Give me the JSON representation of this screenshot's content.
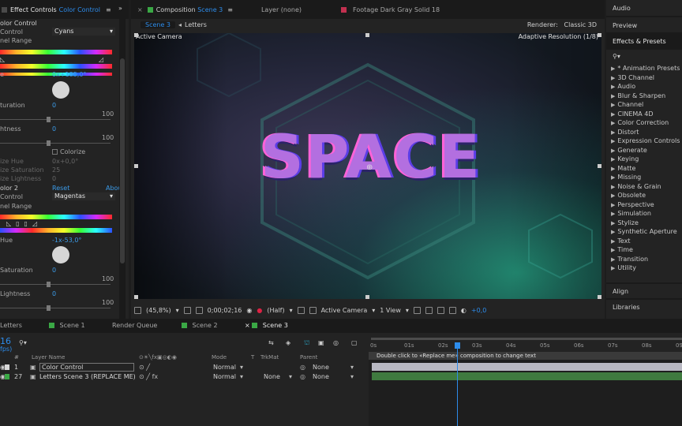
{
  "effects_panel": {
    "tab_title": "Effect Controls",
    "tab_layer": "Color Control",
    "header": "olor Control",
    "control1": {
      "label": "Control",
      "value": "Cyans"
    },
    "range_label": "nel Range",
    "hue_label": "e",
    "hue_value": "0x+185,0°",
    "saturation_label": "turation",
    "saturation_value": "0",
    "sat_max": "100",
    "lightness_label": "htness",
    "lightness_value": "0",
    "light_max": "100",
    "colorize_label": "Colorize",
    "colorize_hue_label": "ize Hue",
    "colorize_hue_value": "0x+0,0°",
    "colorize_sat_label": "ize Saturation",
    "colorize_sat_value": "25",
    "colorize_light_label": "ize Lightness",
    "colorize_light_value": "0",
    "effect2_name": "olor 2",
    "reset": "Reset",
    "about": "Abou",
    "control2": {
      "label": "Control",
      "value": "Magentas"
    },
    "range2_label": "nel Range",
    "hue2_label": "Hue",
    "hue2_value": "-1x-53,0°",
    "saturation2_label": "Saturation",
    "saturation2_value": "0",
    "sat2_max": "100",
    "lightness2_label": "Lightness",
    "lightness2_value": "0",
    "light2_max": "100"
  },
  "viewer": {
    "tabs": [
      {
        "label": "Composition",
        "suffix": "Scene 3",
        "color": "#3aa845"
      },
      {
        "label": "Layer (none)"
      },
      {
        "label": "Footage Dark Gray Solid 18",
        "color": "#c2304f"
      }
    ],
    "breadcrumb": [
      "Scene 3",
      "Letters"
    ],
    "renderer_label": "Renderer:",
    "renderer_value": "Classic 3D",
    "camera_label": "Active Camera",
    "resolution_label": "Adaptive Resolution (1/8)",
    "title_text": "SPACE",
    "toolbar": {
      "zoom": "(45,8%)",
      "timecode": "0;00;02;16",
      "resolution": "(Half)",
      "camera": "Active Camera",
      "view": "1 View",
      "exposure": "+0,0"
    }
  },
  "right_panel": {
    "audio": "Audio",
    "preview": "Preview",
    "effects_presets": "Effects & Presets",
    "search_placeholder": "",
    "categories": [
      "* Animation Presets",
      "3D Channel",
      "Audio",
      "Blur & Sharpen",
      "Channel",
      "CINEMA 4D",
      "Color Correction",
      "Distort",
      "Expression Controls",
      "Generate",
      "Keying",
      "Matte",
      "Missing",
      "Noise & Grain",
      "Obsolete",
      "Perspective",
      "Simulation",
      "Stylize",
      "Synthetic Aperture",
      "Text",
      "Time",
      "Transition",
      "Utility"
    ],
    "align": "Align",
    "libraries": "Libraries"
  },
  "timeline": {
    "tabs": [
      {
        "label": "Letters",
        "color": ""
      },
      {
        "label": "Scene 1",
        "color": "#3aa845"
      },
      {
        "label": "Render Queue",
        "color": ""
      },
      {
        "label": "Scene 2",
        "color": "#3aa845"
      },
      {
        "label": "Scene 3",
        "color": "#3aa845"
      }
    ],
    "timecode": "16",
    "fps": "fps)",
    "columns": {
      "hash": "#",
      "name": "Layer Name",
      "mode": "Mode",
      "t": "T",
      "trkmat": "TrkMat",
      "parent": "Parent"
    },
    "layers": [
      {
        "num": "1",
        "name": "Color Control",
        "mode": "Normal",
        "trkmat": "",
        "parent": "None",
        "color": "#d8d8d8"
      },
      {
        "num": "27",
        "name": "Letters Scene 3 (REPLACE ME)",
        "mode": "Normal",
        "trkmat": "None",
        "parent": "None",
        "color": "#3aa845"
      }
    ],
    "ruler": [
      "0s",
      "01s",
      "02s",
      "03s",
      "04s",
      "05s",
      "06s",
      "07s",
      "08s",
      "09s"
    ],
    "marker_comment": "Double click to «Replace me» composition to change text"
  }
}
